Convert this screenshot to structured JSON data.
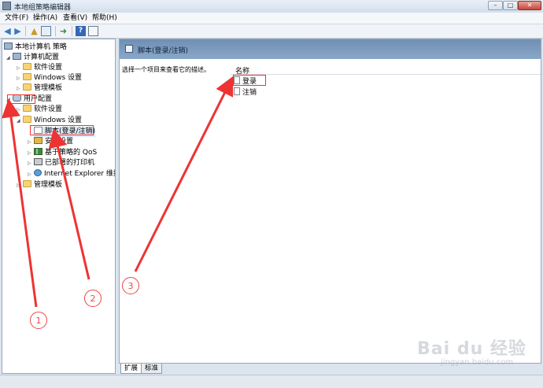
{
  "window": {
    "title": "本地组策略编辑器",
    "controls": {
      "minimize": "–",
      "maximize": "□",
      "close": "✕"
    }
  },
  "menu": [
    "文件(F)",
    "操作(A)",
    "查看(V)",
    "帮助(H)"
  ],
  "toolbar": [
    "back-icon",
    "forward-icon",
    "up-icon",
    "show-hide-tree-icon",
    "export-icon",
    "help-icon",
    "properties-icon"
  ],
  "tree": {
    "root": "本地计算机 策略",
    "computer_config": "计算机配置",
    "cc_software": "软件设置",
    "cc_windows": "Windows 设置",
    "cc_admin": "管理模板",
    "user_config": "用户配置",
    "uc_software": "软件设置",
    "uc_windows": "Windows 设置",
    "uc_scripts": "脚本(登录/注销)",
    "uc_security": "安全设置",
    "uc_qos": "基于策略的 QoS",
    "uc_printers": "已部署的打印机",
    "uc_ie": "Internet Explorer 维护",
    "uc_admin": "管理模板"
  },
  "right_pane": {
    "header_title": "脚本(登录/注销)",
    "description": "选择一个项目来查看它的描述。",
    "column_name": "名称",
    "items": [
      "登录",
      "注销"
    ]
  },
  "tabs": [
    "扩展",
    "标准"
  ],
  "annotations": {
    "numbers": [
      "1",
      "2",
      "3"
    ],
    "color": "#e33333"
  },
  "watermark": {
    "brand": "Bai du 经验",
    "sub": "jingyan.baidu.com"
  }
}
